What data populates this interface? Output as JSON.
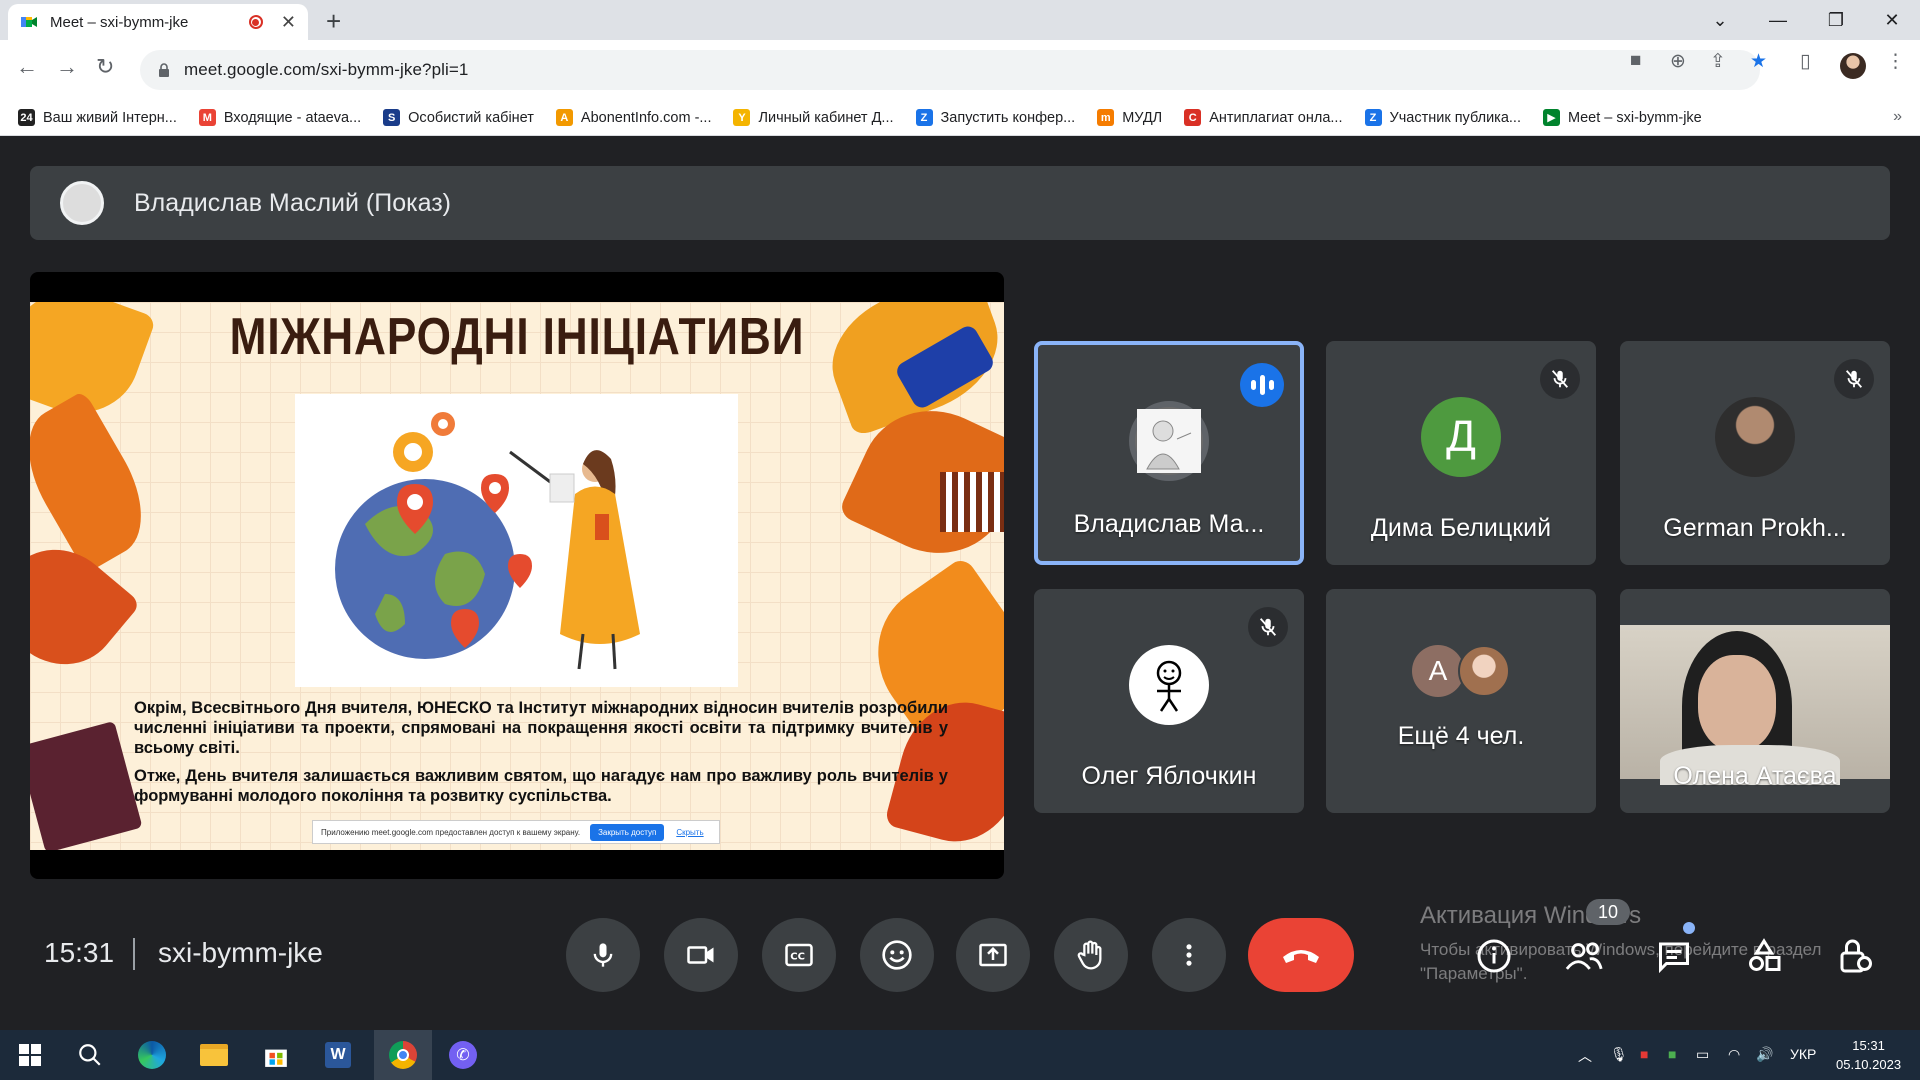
{
  "browser": {
    "tab_title": "Meet – sxi-bymm-jke",
    "url": "meet.google.com/sxi-bymm-jke?pli=1",
    "bookmarks": [
      {
        "label": "Ваш живий Інтерн...",
        "color": "#222222",
        "glyph": "24"
      },
      {
        "label": "Входящие - ataeva...",
        "color": "#ea4335",
        "glyph": "M"
      },
      {
        "label": "Особистий кабінет",
        "color": "#1a3c8a",
        "glyph": "S"
      },
      {
        "label": "AbonentInfo.com -...",
        "color": "#f29900",
        "glyph": "A"
      },
      {
        "label": "Личный кабинет Д...",
        "color": "#f4b400",
        "glyph": "Y"
      },
      {
        "label": "Запустить конфер...",
        "color": "#1a73e8",
        "glyph": "Z"
      },
      {
        "label": "МУДЛ",
        "color": "#f57c00",
        "glyph": "m"
      },
      {
        "label": "Антиплагиат онла...",
        "color": "#d93025",
        "glyph": "C"
      },
      {
        "label": "Участник публика...",
        "color": "#1a73e8",
        "glyph": "Z"
      },
      {
        "label": "Meet – sxi-bymm-jke",
        "color": "#00832d",
        "glyph": "▶"
      }
    ]
  },
  "meet": {
    "presenter_label": "Владислав Маслий (Показ)",
    "slide": {
      "title": "МІЖНАРОДНІ ІНІЦІАТИВИ",
      "paragraph1": "Окрім, Всесвітнього Дня вчителя, ЮНЕСКО та Інститут міжнародних відносин вчителів розробили численні ініціативи та проекти, спрямовані на покращення якості освіти та підтримку вчителів у всьому світі.",
      "paragraph2": "Отже, День вчителя залишається важливим святом, що нагадує нам про важливу роль вчителів у формуванні молодого покоління та розвитку суспільства.",
      "share_notice": "Приложению meet.google.com предоставлен доступ к вашему экрану.",
      "share_stop": "Закрыть доступ",
      "share_hide": "Скрыть"
    },
    "participants": [
      {
        "name": "Владислав Ма...",
        "initial": "",
        "speaking": true
      },
      {
        "name": "Дима Белицкий",
        "initial": "Д",
        "color": "#4e9a3f",
        "muted": true
      },
      {
        "name": "German Prokh...",
        "initial": "",
        "muted": true
      },
      {
        "name": "Олег Яблочкин",
        "initial": "",
        "muted": true
      },
      {
        "name": "Ещё 4 чел.",
        "initial": "A",
        "color": "#8d6e63"
      },
      {
        "name": "Олена Атаєва",
        "initial": ""
      }
    ],
    "time": "15:31",
    "meeting_code": "sxi-bymm-jke",
    "participant_count": "10",
    "watermark_title": "Активация Windows",
    "watermark_sub": "Чтобы активировать Windows, перейдите в раздел \"Параметры\"."
  },
  "taskbar": {
    "lang": "УКР",
    "time": "15:31",
    "date": "05.10.2023"
  }
}
